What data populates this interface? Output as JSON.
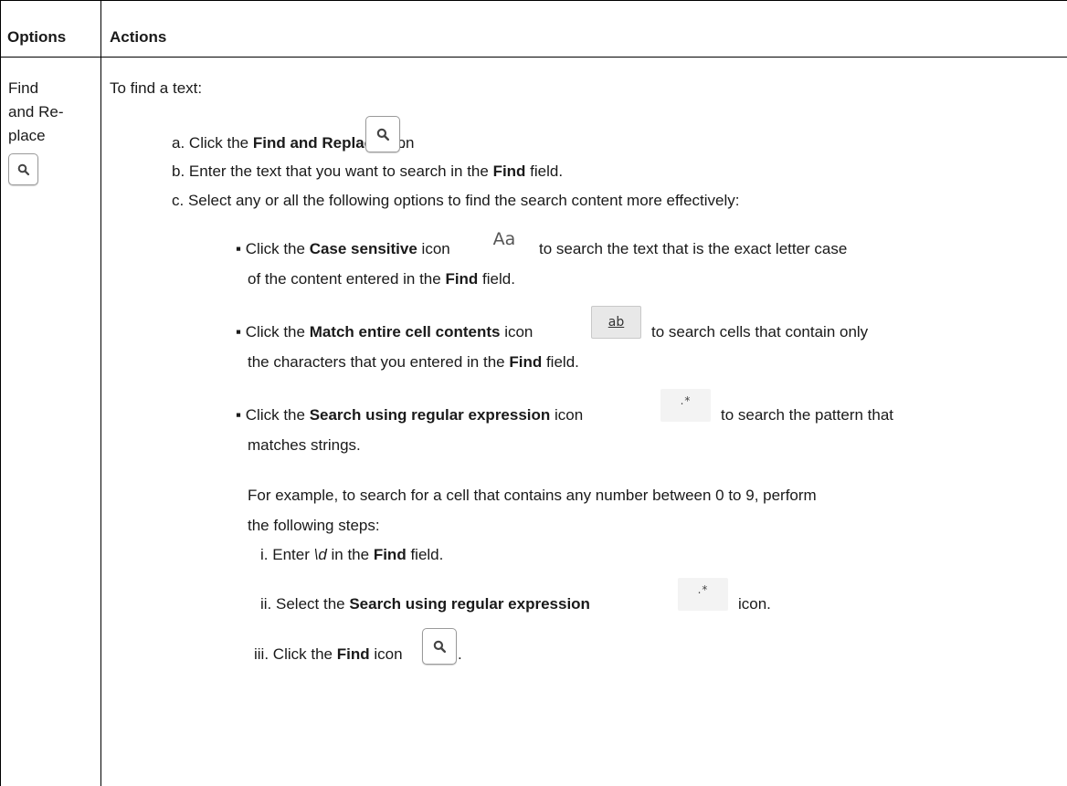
{
  "table": {
    "headers": [
      "Options",
      "Actions"
    ],
    "option_label": [
      "Find",
      "and Re-",
      "place"
    ],
    "intro": "To find a text:",
    "steps": [
      {
        "marker": "a.",
        "pre": "Click the ",
        "bold": "Find and Replace",
        "post": " icon",
        "tail": "."
      },
      {
        "marker": "b.",
        "pre": "Enter the text that you want to search in the ",
        "bold": "Find",
        "post": " field."
      },
      {
        "marker": "c.",
        "text": "Select any or all the following options to find the search content more effectively:"
      }
    ],
    "bullets": [
      {
        "marker": "▪",
        "pre": "Click the ",
        "bold": "Case sensitive",
        "mid": " icon",
        "post": "to search the text that is the exact letter case",
        "line2_pre": "of the content entered in the ",
        "line2_bold": "Find",
        "line2_post": " field."
      },
      {
        "marker": "▪",
        "pre": "Click the ",
        "bold": "Match entire cell contents",
        "mid": " icon",
        "post": "to search cells that contain only",
        "line2_pre": "the characters that you entered in the ",
        "line2_bold": "Find",
        "line2_post": " field."
      },
      {
        "marker": "▪",
        "pre": "Click the ",
        "bold": "Search using regular expression",
        "mid": " icon",
        "post": "to search the pattern that",
        "line2": "matches strings."
      }
    ],
    "example": [
      "For example, to search for a cell that contains any number between 0 to 9, perform",
      "the following steps:"
    ],
    "substeps": [
      {
        "marker": "i.",
        "pre": "Enter ",
        "italic": "\\d",
        "mid": " in the ",
        "bold": "Find",
        "post": " field."
      },
      {
        "marker": "ii.",
        "pre": "Select the ",
        "bold": "Search using regular expression",
        "post": "icon."
      },
      {
        "marker": "iii.",
        "pre": "Click the ",
        "bold": "Find",
        "post": " icon",
        "tail": "."
      }
    ],
    "icons": {
      "case_sensitive": "Aa",
      "match_cell": "ab",
      "regex": ".*",
      "search": "magnifier-icon"
    }
  }
}
